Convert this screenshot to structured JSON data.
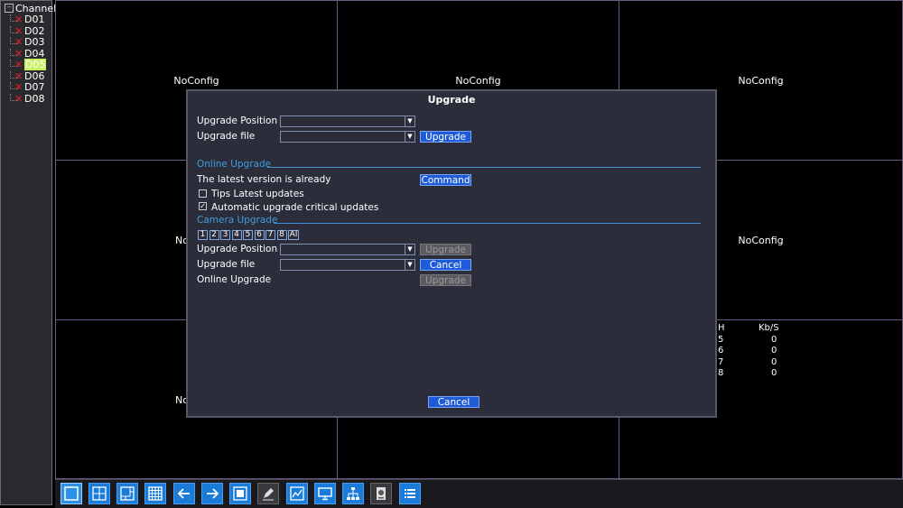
{
  "sidebar": {
    "title": "Channel",
    "channels": [
      {
        "label": "D01",
        "selected": false
      },
      {
        "label": "D02",
        "selected": false
      },
      {
        "label": "D03",
        "selected": false
      },
      {
        "label": "D04",
        "selected": false
      },
      {
        "label": "D05",
        "selected": true
      },
      {
        "label": "D06",
        "selected": false
      },
      {
        "label": "D07",
        "selected": false
      },
      {
        "label": "D08",
        "selected": false
      }
    ]
  },
  "grid": {
    "noconfig_label": "NoConfig",
    "partial_label": "No",
    "stats_header": {
      "ch": "H",
      "kbs": "Kb/S"
    },
    "stats_rows": [
      {
        "ch": "5",
        "kbs": "0"
      },
      {
        "ch": "6",
        "kbs": "0"
      },
      {
        "ch": "7",
        "kbs": "0"
      },
      {
        "ch": "8",
        "kbs": "0"
      }
    ]
  },
  "dialog": {
    "title": "Upgrade",
    "upgrade_position_label": "Upgrade Position",
    "upgrade_position_value": "",
    "upgrade_file_label": "Upgrade file",
    "upgrade_file_value": "",
    "upgrade_button": "Upgrade",
    "online_upgrade_section": "Online Upgrade",
    "latest_version_text": "The latest version is already",
    "command_button": "Command",
    "tips_label": "Tips Latest updates",
    "tips_checked": false,
    "auto_label": "Automatic upgrade critical updates",
    "auto_checked": true,
    "camera_upgrade_section": "Camera Upgrade",
    "camera_channels": [
      "1",
      "2",
      "3",
      "4",
      "5",
      "6",
      "7",
      "8",
      "Al"
    ],
    "cam_upgrade_position_label": "Upgrade Position",
    "cam_upgrade_position_value": "",
    "cam_upgrade_button": "Upgrade",
    "cam_upgrade_file_label": "Upgrade file",
    "cam_upgrade_file_value": "",
    "cam_cancel_button": "Cancel",
    "cam_online_label": "Online Upgrade",
    "cam_online_button": "Upgrade",
    "cancel_button": "Cancel"
  },
  "toolbar": {
    "icons": [
      "single-view-icon",
      "quad-view-icon",
      "nine-view-icon",
      "sixteen-view-icon",
      "previous-icon",
      "next-icon",
      "fullscreen-icon",
      "edit-icon",
      "chart-icon",
      "monitor-icon",
      "network-icon",
      "storage-icon",
      "menu-list-icon"
    ]
  },
  "colors": {
    "accent_blue": "#1f5bd8",
    "section_blue": "#3f9fe0",
    "error_red": "#e02020",
    "selected_green": "#c8f060",
    "grid_border": "#6e5a8a"
  }
}
